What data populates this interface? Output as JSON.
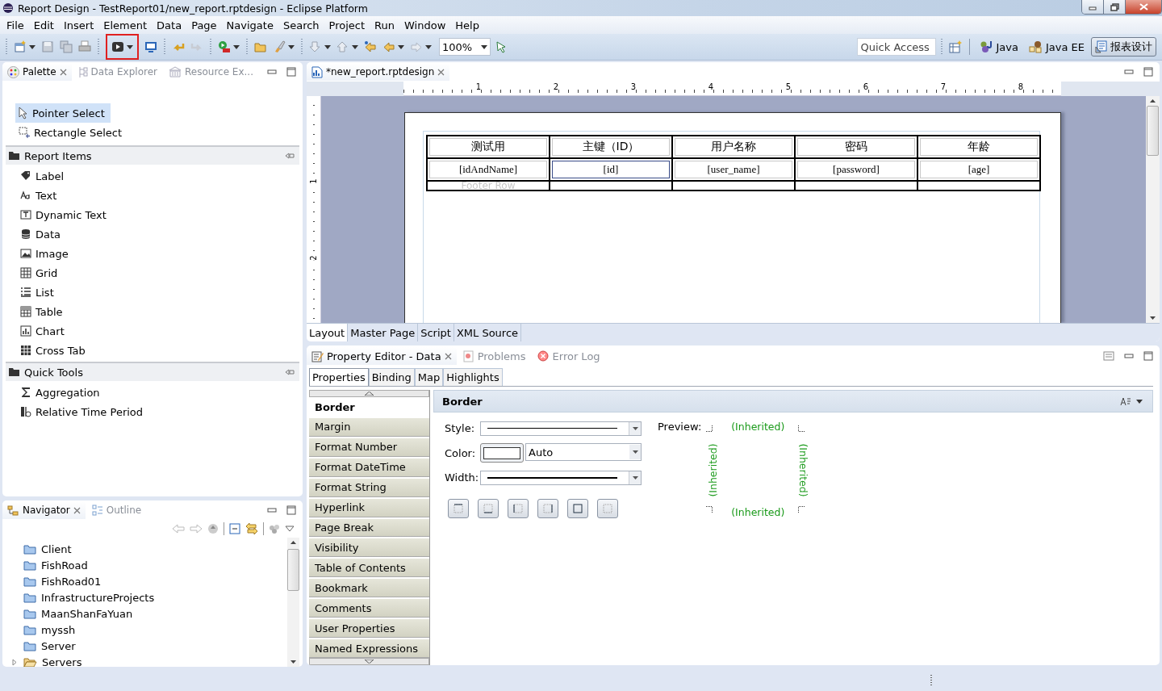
{
  "window": {
    "title": "Report Design - TestReport01/new_report.rptdesign - Eclipse Platform"
  },
  "menu": [
    "File",
    "Edit",
    "Insert",
    "Element",
    "Data",
    "Page",
    "Navigate",
    "Search",
    "Project",
    "Run",
    "Window",
    "Help"
  ],
  "toolbar": {
    "zoom": "100%",
    "quick_access": {
      "placeholder": "Quick Access"
    },
    "perspectives": [
      {
        "label": "Java",
        "selected": false
      },
      {
        "label": "Java EE",
        "selected": false
      },
      {
        "label": "报表设计",
        "selected": true
      }
    ]
  },
  "palette_panel": {
    "tabs": [
      {
        "label": "Palette",
        "selected": true
      },
      {
        "label": "Data Explorer",
        "selected": false
      },
      {
        "label": "Resource Ex...",
        "selected": false
      }
    ],
    "tools": [
      {
        "label": "Pointer Select",
        "selected": true
      },
      {
        "label": "Rectangle Select",
        "selected": false
      }
    ],
    "groups": [
      {
        "label": "Report Items",
        "items": [
          "Label",
          "Text",
          "Dynamic Text",
          "Data",
          "Image",
          "Grid",
          "List",
          "Table",
          "Chart",
          "Cross Tab"
        ]
      },
      {
        "label": "Quick Tools",
        "items": [
          "Aggregation",
          "Relative Time Period"
        ]
      }
    ]
  },
  "navigator_panel": {
    "tabs": [
      {
        "label": "Navigator",
        "selected": true
      },
      {
        "label": "Outline",
        "selected": false
      }
    ],
    "tree": [
      {
        "label": "Client",
        "expandable": false
      },
      {
        "label": "FishRoad",
        "expandable": false
      },
      {
        "label": "FishRoad01",
        "expandable": false
      },
      {
        "label": "InfrastructureProjects",
        "expandable": false
      },
      {
        "label": "MaanShanFaYuan",
        "expandable": false
      },
      {
        "label": "myssh",
        "expandable": false
      },
      {
        "label": "Server",
        "expandable": false
      },
      {
        "label": "Servers",
        "expandable": true
      }
    ]
  },
  "editor": {
    "tab": "*new_report.rptdesign",
    "ruler": [
      "1",
      "2",
      "3",
      "4",
      "5",
      "6",
      "7",
      "8"
    ],
    "vertical_ruler": [
      "1",
      "2"
    ],
    "table": {
      "header": [
        "测试用",
        "主键（ID）",
        "用户名称",
        "密码",
        "年龄"
      ],
      "detail": [
        {
          "text": "[idAndName]",
          "selected": false
        },
        {
          "text": "[id]",
          "selected": true
        },
        {
          "text": "[user_name]",
          "selected": false
        },
        {
          "text": "[password]",
          "selected": false
        },
        {
          "text": "[age]",
          "selected": false
        }
      ],
      "footer_hint": "Footer Row"
    },
    "bottom_tabs": [
      {
        "label": "Layout",
        "selected": true
      },
      {
        "label": "Master Page",
        "selected": false
      },
      {
        "label": "Script",
        "selected": false
      },
      {
        "label": "XML Source",
        "selected": false
      }
    ]
  },
  "property_editor": {
    "tabs": [
      {
        "label": "Property Editor - Data",
        "selected": true
      },
      {
        "label": "Problems",
        "selected": false
      },
      {
        "label": "Error Log",
        "selected": false
      }
    ],
    "subtabs": [
      {
        "label": "Properties",
        "selected": true
      },
      {
        "label": "Binding",
        "selected": false
      },
      {
        "label": "Map",
        "selected": false
      },
      {
        "label": "Highlights",
        "selected": false
      }
    ],
    "categories": [
      {
        "label": "Border",
        "selected": true
      },
      {
        "label": "Margin",
        "selected": false
      },
      {
        "label": "Format Number",
        "selected": false
      },
      {
        "label": "Format DateTime",
        "selected": false
      },
      {
        "label": "Format String",
        "selected": false
      },
      {
        "label": "Hyperlink",
        "selected": false
      },
      {
        "label": "Page Break",
        "selected": false
      },
      {
        "label": "Visibility",
        "selected": false
      },
      {
        "label": "Table of Contents",
        "selected": false
      },
      {
        "label": "Bookmark",
        "selected": false
      },
      {
        "label": "Comments",
        "selected": false
      },
      {
        "label": "User Properties",
        "selected": false
      },
      {
        "label": "Named Expressions",
        "selected": false
      }
    ],
    "section_title": "Border",
    "style_label": "Style:",
    "color_label": "Color:",
    "color_value": "Auto",
    "width_label": "Width:",
    "preview": {
      "label": "Preview:",
      "top": "(Inherited)",
      "left": "(Inherited)",
      "right": "(Inherited)",
      "bottom": "(Inherited)"
    }
  }
}
